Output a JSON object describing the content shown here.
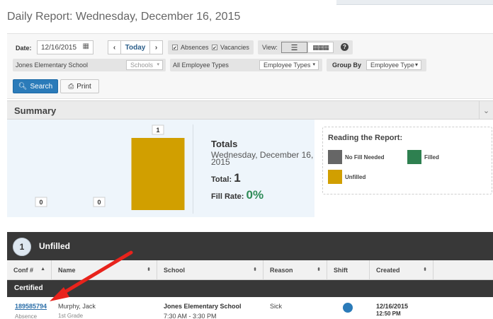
{
  "header": {
    "title": "Daily Report: Wednesday, December 16, 2015"
  },
  "filters": {
    "date_label": "Date:",
    "date_value": "12/16/2015",
    "today_label": "Today",
    "absences_label": "Absences",
    "vacancies_label": "Vacancies",
    "view_label": "View:",
    "school_name": "Jones Elementary School",
    "schools_dropdown": "Schools",
    "employee_types_text": "All Employee Types",
    "employee_types_dropdown": "Employee Types",
    "group_by_label": "Group By",
    "group_by_value": "Employee Type"
  },
  "actions": {
    "search_label": "Search",
    "print_label": "Print"
  },
  "summary": {
    "title": "Summary",
    "totals_title": "Totals",
    "totals_date": "Wednesday, December 16, 2015",
    "total_label": "Total:",
    "total_value": "1",
    "fill_rate_label": "Fill Rate:",
    "fill_rate_value": "0%"
  },
  "chart_data": {
    "type": "bar",
    "categories": [
      "No Fill Needed",
      "Filled",
      "Unfilled"
    ],
    "values": [
      0,
      0,
      1
    ],
    "colors": [
      "#666666",
      "#2e8050",
      "#d19f00"
    ],
    "ylim": [
      0,
      1
    ],
    "title": "",
    "xlabel": "",
    "ylabel": ""
  },
  "legend": {
    "title": "Reading the Report:",
    "items": [
      {
        "label": "No Fill Needed",
        "color": "#666666"
      },
      {
        "label": "Filled",
        "color": "#2e8050"
      },
      {
        "label": "Unfilled",
        "color": "#d19f00"
      }
    ]
  },
  "unfilled_section": {
    "count": "1",
    "label": "Unfilled",
    "columns": [
      "Conf #",
      "Name",
      "School",
      "Reason",
      "Shift",
      "Created"
    ],
    "group_label": "Certified",
    "rows": [
      {
        "conf": "189585794",
        "type": "Absence",
        "name": "Murphy, Jack",
        "grade": "1st Grade",
        "school": "Jones Elementary School",
        "time": "7:30 AM - 3:30 PM",
        "reason": "Sick",
        "created_date": "12/16/2015",
        "created_time": "12:50 PM"
      }
    ]
  },
  "colors": {
    "accent": "#2b7bb9",
    "fill_rate": "#2e8b57",
    "dark_bar": "#383838"
  }
}
